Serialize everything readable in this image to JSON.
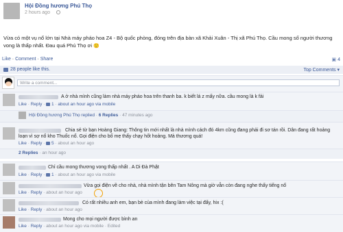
{
  "post": {
    "author": "Hội Đồng hương Phú Thọ",
    "time": "2 hours ago",
    "text": "Vừa có một vụ nổ lớn tại Nhà máy pháo hoa Z4 - Bộ quốc phòng, đóng trên địa bàn xã Khải Xuân - Thị xã Phú Thọ. Cầu mong số người thương vong là thấp nhất. Đau quá Phú Thọ ơi",
    "emoji": "🙂"
  },
  "actions": {
    "like": "Like",
    "comment": "Comment",
    "share": "Share",
    "comment_count": "4"
  },
  "likes": {
    "text": "28 people like this.",
    "top_comments": "Top Comments"
  },
  "write_comment": {
    "placeholder": "Write a comment..."
  },
  "comments": [
    {
      "text": "A ở nhà mình cũng làm nhà máy pháo hoa trên thanh ba. k biết lá z mấy nữa.  cầu mong là k fải",
      "meta_like": "Like",
      "meta_reply": "Reply",
      "meta_likes": "1",
      "meta_time": "about an hour ago via mobile"
    },
    {
      "replied_name": "Hội Đồng hương Phú Thọ replied",
      "replies": "6 Replies",
      "time": "47 minutes ago"
    },
    {
      "text": "Chia sẻ từ bạn Hoàng Giang: Thông tin mới nhất là nhà mình cách đó 4km cũng đang phải đi sơ tán rồi. Dân đang rất hoảng loạn vì sợ nổ kho Thuốc nổ. Gọi điện cho bố mẹ thấy chạy hốt hoảng. Mà thương quá!",
      "meta_like": "Like",
      "meta_reply": "Reply",
      "meta_likes": "5",
      "meta_time": "about an hour ago"
    },
    {
      "replies": "2 Replies",
      "time": "an hour ago"
    },
    {
      "text": "Chỉ cầu mong thương vong thấp nhất . A Di Đà Phật",
      "meta_like": "Like",
      "meta_reply": "Reply",
      "meta_likes": "1",
      "meta_time": "about an hour ago via mobile"
    },
    {
      "text": "Vừa gọi điện về cho nhà, nhà mình tận bên Tam Nông mà giờ vẫn còn đang nghe thấy tiếng nổ",
      "meta_like": "Like",
      "meta_reply": "Reply",
      "meta_time": "about an hour ago"
    },
    {
      "text": "Có rất nhiều anh em, bạn bè của mình đang làm việc tại đấy, hix :(",
      "meta_like": "Like",
      "meta_reply": "Reply",
      "meta_time": "about an hour ago"
    },
    {
      "text": "Mong cho mọi người được bình an",
      "meta_like": "Like",
      "meta_reply": "Reply",
      "meta_time": "about an hour ago via mobile",
      "meta_edited": "Edited"
    }
  ],
  "symbols": {
    "dot": "·",
    "close": "x",
    "arrow": "▾",
    "comment_icon": "▣"
  }
}
